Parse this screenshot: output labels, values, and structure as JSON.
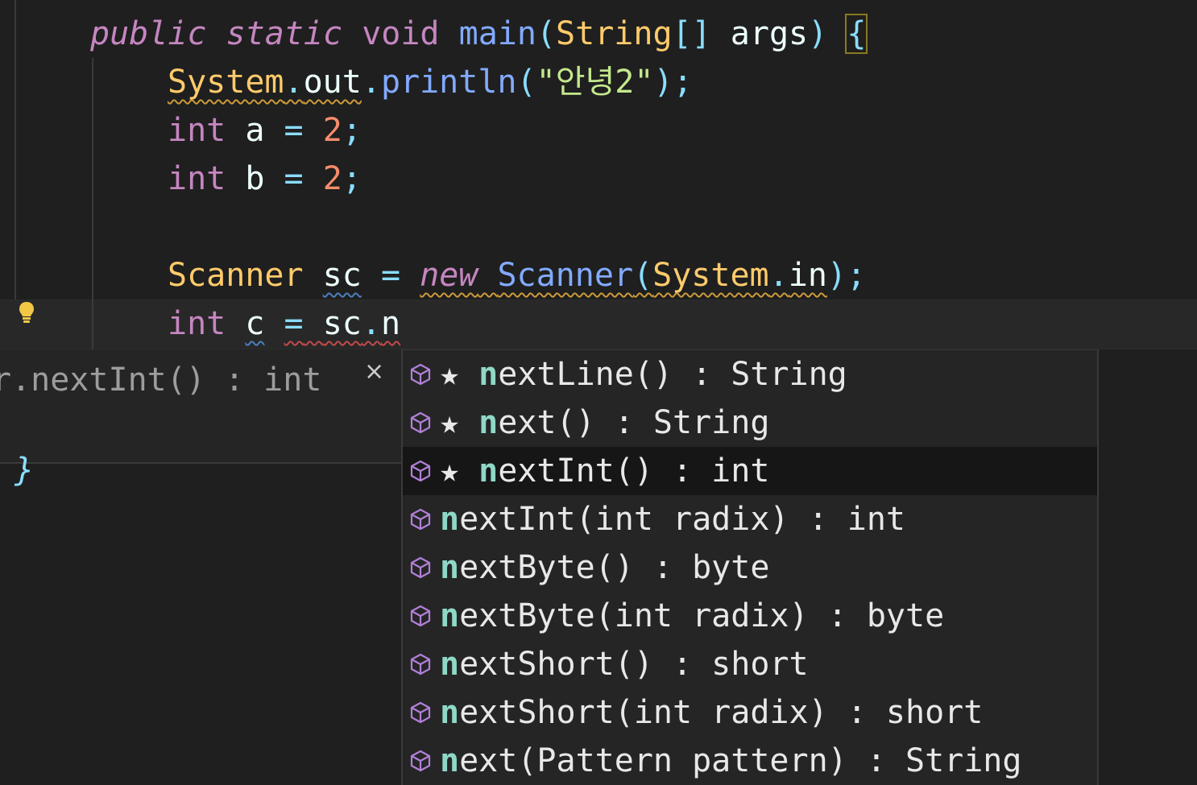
{
  "code": {
    "line1": {
      "public": "public",
      "static": "static",
      "void": "void",
      "main": "main",
      "lparen": "(",
      "String": "String",
      "brackets": "[]",
      "args": "args",
      "rparen": ")",
      "brace": "{"
    },
    "line2": {
      "System": "System",
      "dot1": ".",
      "out": "out",
      "dot2": ".",
      "println": "println",
      "lparen": "(",
      "string": "\"안녕2\"",
      "rparen": ")",
      "semi": ";"
    },
    "line3": {
      "int": "int",
      "name": "a",
      "eq": "=",
      "value": "2",
      "semi": ";"
    },
    "line4": {
      "int": "int",
      "name": "b",
      "eq": "=",
      "value": "2",
      "semi": ";"
    },
    "line6": {
      "Scanner": "Scanner",
      "name": "sc",
      "eq": "=",
      "new": "new",
      "Scanner2": "Scanner",
      "lparen": "(",
      "System": "System",
      "dot": ".",
      "in": "in",
      "rparen": ")",
      "semi": ";"
    },
    "line7": {
      "int": "int",
      "name": "c",
      "eq": "=",
      "obj": "sc",
      "dot": ".",
      "typed": "n"
    },
    "stray_brace": "}"
  },
  "detail_panel": {
    "signature": "r.nextInt() : int",
    "close_glyph": "×"
  },
  "suggestions": [
    {
      "match": "n",
      "rest": "extLine() : String",
      "starred": true
    },
    {
      "match": "n",
      "rest": "ext() : String",
      "starred": true
    },
    {
      "match": "n",
      "rest": "extInt() : int",
      "starred": true,
      "selected": true
    },
    {
      "match": "n",
      "rest": "extInt(int radix) : int",
      "starred": false
    },
    {
      "match": "n",
      "rest": "extByte() : byte",
      "starred": false
    },
    {
      "match": "n",
      "rest": "extByte(int radix) : byte",
      "starred": false
    },
    {
      "match": "n",
      "rest": "extShort() : short",
      "starred": false
    },
    {
      "match": "n",
      "rest": "extShort(int radix) : short",
      "starred": false
    },
    {
      "match": "n",
      "rest": "ext(Pattern pattern) : String",
      "starred": false
    }
  ],
  "star_glyph": "★ ",
  "icons": {
    "method": "method-cube-icon",
    "hint": "lightbulb-icon"
  },
  "colors": {
    "keyword": "#c586c0",
    "class": "#ffcb6b",
    "function": "#82aaff",
    "number": "#f78c6c",
    "string": "#c3e88d",
    "match": "#8fd8c8"
  }
}
